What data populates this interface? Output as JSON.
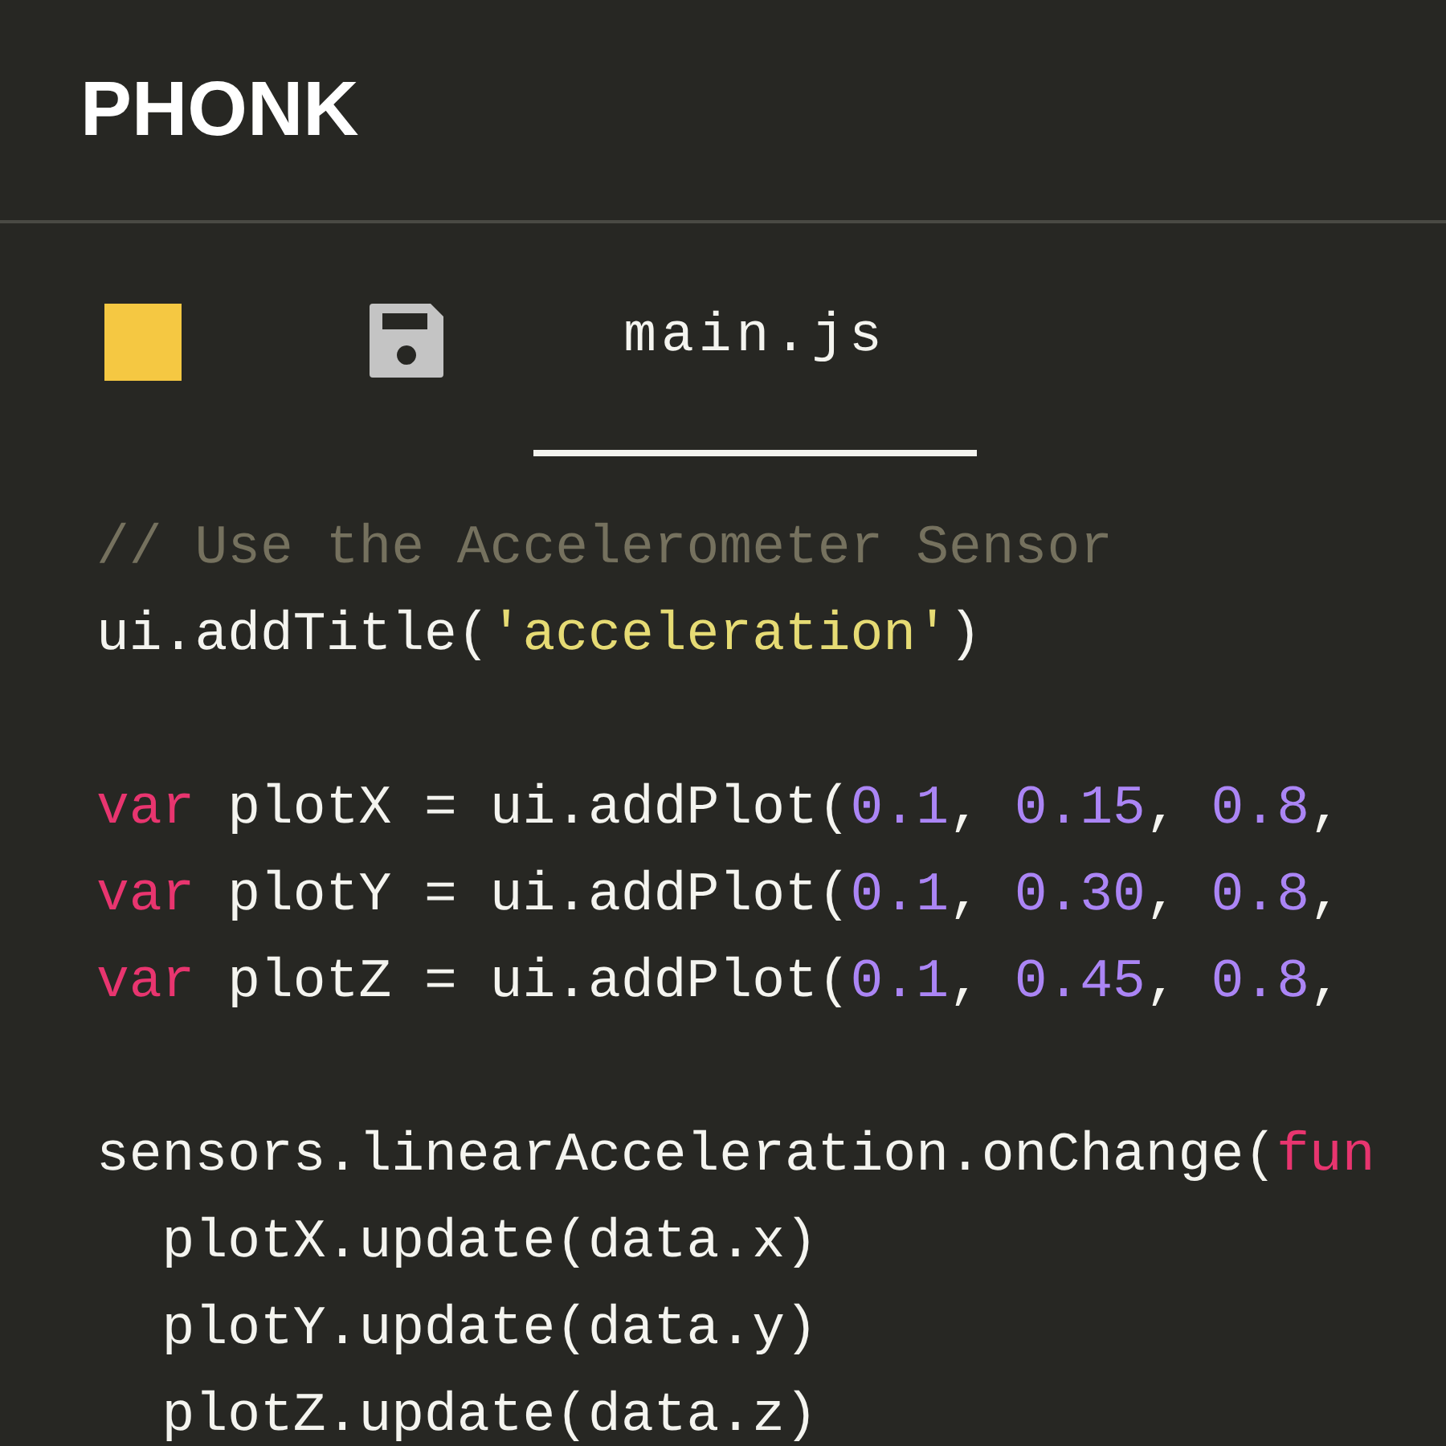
{
  "app": {
    "title": "PHONK"
  },
  "toolbar": {
    "tabs": [
      {
        "label": "main.js",
        "selected": true
      }
    ]
  },
  "editor": {
    "lines": [
      {
        "kind": "code",
        "tokens": [
          {
            "kind": "comment",
            "text": "// Use the Accelerometer Sensor"
          }
        ]
      },
      {
        "kind": "code",
        "tokens": [
          {
            "kind": "plain",
            "text": "ui.addTitle("
          },
          {
            "kind": "string",
            "text": "'acceleration'"
          },
          {
            "kind": "plain",
            "text": ")"
          }
        ]
      },
      {
        "kind": "blank"
      },
      {
        "kind": "code",
        "tokens": [
          {
            "kind": "keyword",
            "text": "var"
          },
          {
            "kind": "plain",
            "text": " plotX = ui.addPlot("
          },
          {
            "kind": "number",
            "text": "0.1"
          },
          {
            "kind": "plain",
            "text": ", "
          },
          {
            "kind": "number",
            "text": "0.15"
          },
          {
            "kind": "plain",
            "text": ", "
          },
          {
            "kind": "number",
            "text": "0.8"
          },
          {
            "kind": "plain",
            "text": ","
          }
        ]
      },
      {
        "kind": "code",
        "tokens": [
          {
            "kind": "keyword",
            "text": "var"
          },
          {
            "kind": "plain",
            "text": " plotY = ui.addPlot("
          },
          {
            "kind": "number",
            "text": "0.1"
          },
          {
            "kind": "plain",
            "text": ", "
          },
          {
            "kind": "number",
            "text": "0.30"
          },
          {
            "kind": "plain",
            "text": ", "
          },
          {
            "kind": "number",
            "text": "0.8"
          },
          {
            "kind": "plain",
            "text": ","
          }
        ]
      },
      {
        "kind": "code",
        "tokens": [
          {
            "kind": "keyword",
            "text": "var"
          },
          {
            "kind": "plain",
            "text": " plotZ = ui.addPlot("
          },
          {
            "kind": "number",
            "text": "0.1"
          },
          {
            "kind": "plain",
            "text": ", "
          },
          {
            "kind": "number",
            "text": "0.45"
          },
          {
            "kind": "plain",
            "text": ", "
          },
          {
            "kind": "number",
            "text": "0.8"
          },
          {
            "kind": "plain",
            "text": ","
          }
        ]
      },
      {
        "kind": "blank"
      },
      {
        "kind": "code",
        "tokens": [
          {
            "kind": "plain",
            "text": "sensors.linearAcceleration.onChange("
          },
          {
            "kind": "keyword",
            "text": "fun"
          }
        ]
      },
      {
        "kind": "code",
        "tokens": [
          {
            "kind": "plain",
            "text": "  plotX.update(data.x)"
          }
        ]
      },
      {
        "kind": "code",
        "tokens": [
          {
            "kind": "plain",
            "text": "  plotY.update(data.y)"
          }
        ]
      },
      {
        "kind": "code",
        "tokens": [
          {
            "kind": "plain",
            "text": "  plotZ.update(data.z)"
          }
        ]
      }
    ]
  }
}
